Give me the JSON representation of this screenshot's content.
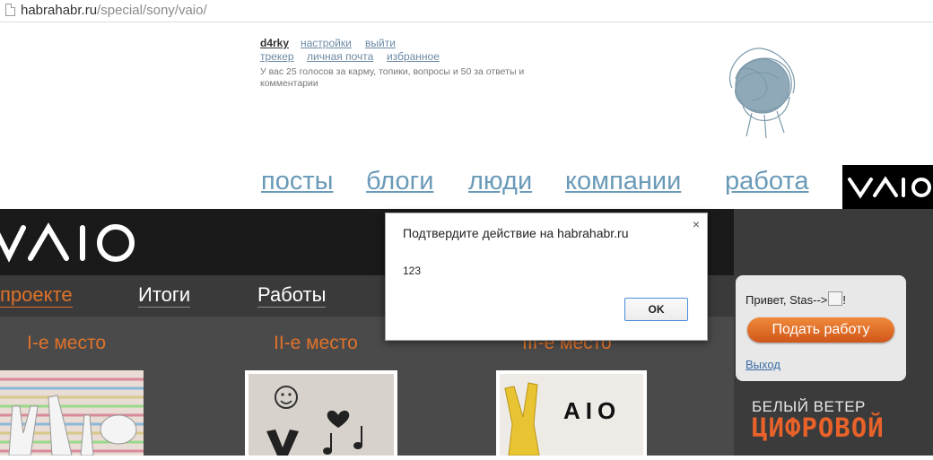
{
  "browser": {
    "url_host": "habrahabr.ru",
    "url_path": "/special/sony/vaio/"
  },
  "user_panel": {
    "username": "d4rky",
    "settings": "настройки",
    "logout": "выйти",
    "tracker": "трекер",
    "mail": "личная почта",
    "favorites": "избранное",
    "votes": "У вас 25 голосов за карму, топики, вопросы и 50 за ответы и комментарии"
  },
  "nav": {
    "posts": "посты",
    "blogs": "блоги",
    "people": "люди",
    "companies": "компании",
    "jobs": "работа"
  },
  "brand": {
    "vaio": "VAIO"
  },
  "section_menu": {
    "about": "проекте",
    "results": "Итоги",
    "works": "Работы"
  },
  "places": {
    "first": "I-е место",
    "second": "II-е место",
    "third": "III-е место"
  },
  "thumb_text": {
    "aio": "AIO"
  },
  "sidebar": {
    "hello": "Привет, Stas-->",
    "hello_end": "!",
    "submit": "Подать работу",
    "logout": "Выход",
    "wind_line1": "БЕЛЫЙ ВЕТЕР",
    "wind_line2": "ЦИФРОВОЙ"
  },
  "dialog": {
    "title": "Подтвердите действие на habrahabr.ru",
    "message": "123",
    "ok": "OK",
    "close": "×"
  },
  "colors": {
    "accent_orange": "#e0722a",
    "link_blue": "#6a9ab8",
    "dark_bg": "#1a1a1a"
  }
}
